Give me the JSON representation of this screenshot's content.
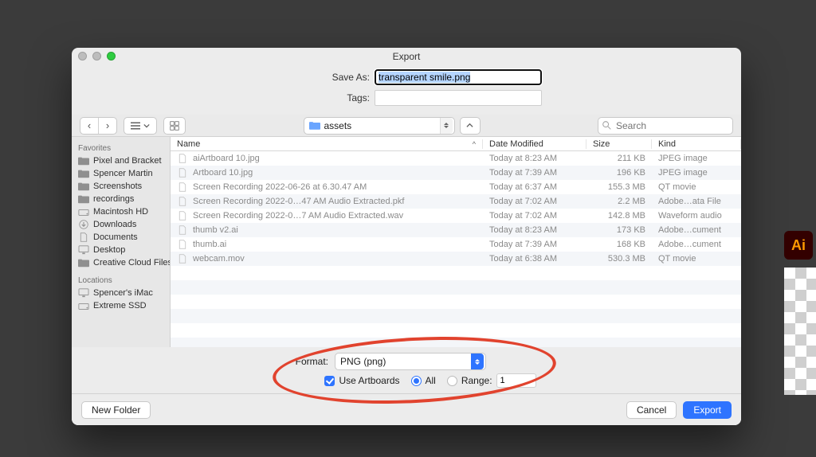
{
  "window": {
    "title": "Export"
  },
  "form": {
    "save_label": "Save As:",
    "save_value": "transparent smile.png",
    "tags_label": "Tags:",
    "tags_value": ""
  },
  "toolbar": {
    "folder_name": "assets",
    "search_placeholder": "Search"
  },
  "sidebar": {
    "favorites_header": "Favorites",
    "locations_header": "Locations",
    "favorites": [
      "Pixel and Bracket",
      "Spencer Martin",
      "Screenshots",
      "recordings",
      "Macintosh HD",
      "Downloads",
      "Documents",
      "Desktop",
      "Creative Cloud Files"
    ],
    "locations": [
      "Spencer's iMac",
      "Extreme SSD"
    ]
  },
  "columns": {
    "name": "Name",
    "date": "Date Modified",
    "size": "Size",
    "kind": "Kind"
  },
  "files": [
    {
      "name": "aiArtboard 10.jpg",
      "date": "Today at 8:23 AM",
      "size": "211 KB",
      "kind": "JPEG image"
    },
    {
      "name": "Artboard 10.jpg",
      "date": "Today at 7:39 AM",
      "size": "196 KB",
      "kind": "JPEG image"
    },
    {
      "name": "Screen Recording 2022-06-26 at 6.30.47 AM",
      "date": "Today at 6:37 AM",
      "size": "155.3 MB",
      "kind": "QT movie"
    },
    {
      "name": "Screen Recording 2022-0…47 AM Audio Extracted.pkf",
      "date": "Today at 7:02 AM",
      "size": "2.2 MB",
      "kind": "Adobe…ata File"
    },
    {
      "name": "Screen Recording 2022-0…7 AM Audio Extracted.wav",
      "date": "Today at 7:02 AM",
      "size": "142.8 MB",
      "kind": "Waveform audio"
    },
    {
      "name": "thumb v2.ai",
      "date": "Today at 8:23 AM",
      "size": "173 KB",
      "kind": "Adobe…cument"
    },
    {
      "name": "thumb.ai",
      "date": "Today at 7:39 AM",
      "size": "168 KB",
      "kind": "Adobe…cument"
    },
    {
      "name": "webcam.mov",
      "date": "Today at 6:38 AM",
      "size": "530.3 MB",
      "kind": "QT movie"
    }
  ],
  "format": {
    "label": "Format:",
    "value": "PNG (png)",
    "use_artboards_label": "Use Artboards",
    "all_label": "All",
    "range_label": "Range:",
    "range_value": "1"
  },
  "footer": {
    "new_folder": "New Folder",
    "cancel": "Cancel",
    "export": "Export"
  },
  "ai_badge": "Ai"
}
